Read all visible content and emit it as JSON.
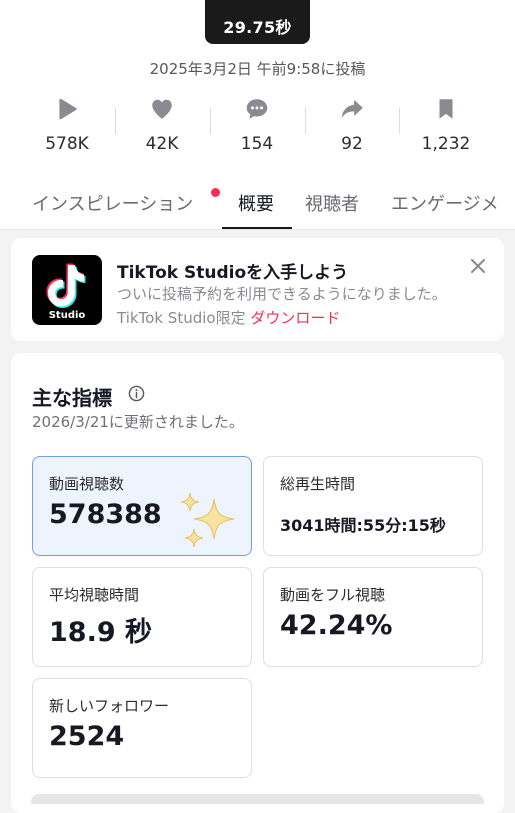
{
  "video": {
    "duration": "29.75秒"
  },
  "post_date": "2025年3月2日 午前9:58に投稿",
  "stats": [
    {
      "icon": "play-icon",
      "value": "578K"
    },
    {
      "icon": "heart-icon",
      "value": "42K"
    },
    {
      "icon": "comment-icon",
      "value": "154"
    },
    {
      "icon": "share-icon",
      "value": "92"
    },
    {
      "icon": "bookmark-icon",
      "value": "1,232"
    }
  ],
  "tabs": [
    {
      "label": "インスピレーション",
      "active": false,
      "has_dot": true
    },
    {
      "label": "概要",
      "active": true
    },
    {
      "label": "視聴者",
      "active": false
    },
    {
      "label": "エンゲージメ",
      "active": false
    }
  ],
  "banner": {
    "logo_label": "Studio",
    "title": "TikTok Studioを入手しよう",
    "desc": "ついに投稿予約を利用できるようになりました。TikTok Studio限定 ",
    "link": "ダウンロード"
  },
  "metrics": {
    "title": "主な指標",
    "updated": "2026/3/21に更新されました。",
    "items": [
      {
        "label": "動画視聴数",
        "value": "578388"
      },
      {
        "label": "総再生時間",
        "value": "3041時間:55分:15秒"
      },
      {
        "label": "平均視聴時間",
        "value": "18.9 秒"
      },
      {
        "label": "動画をフル視聴",
        "value": "42.24%"
      },
      {
        "label": "新しいフォロワー",
        "value": "2524"
      }
    ]
  },
  "colors": {
    "accent": "#fe2c55",
    "highlight_border": "#6ea0e4",
    "highlight_bg": "#eef4fe",
    "sparkle": "#f1d889"
  }
}
